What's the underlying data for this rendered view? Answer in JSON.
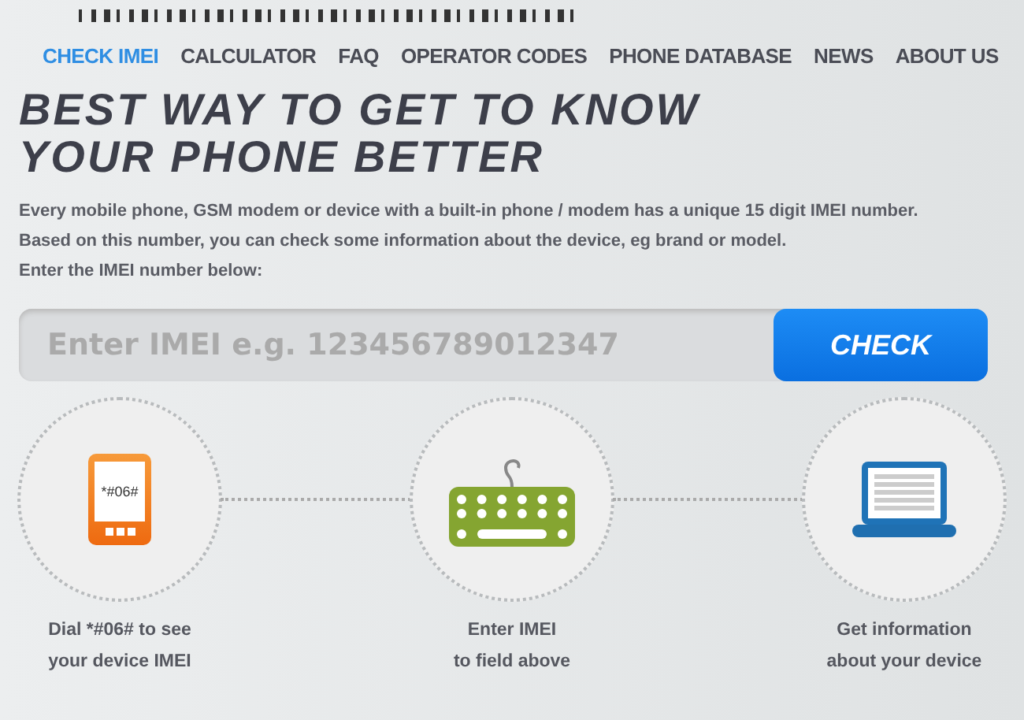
{
  "nav": [
    {
      "label": "CHECK IMEI",
      "selected": true
    },
    {
      "label": "CALCULATOR",
      "selected": false
    },
    {
      "label": "FAQ",
      "selected": false
    },
    {
      "label": "OPERATOR CODES",
      "selected": false
    },
    {
      "label": "PHONE DATABASE",
      "selected": false
    },
    {
      "label": "NEWS",
      "selected": false
    },
    {
      "label": "ABOUT US",
      "selected": false
    }
  ],
  "headline": [
    "BEST WAY TO GET TO KNOW",
    "YOUR PHONE BETTER"
  ],
  "intro": [
    "Every mobile phone, GSM modem or device with a built-in phone / modem has a unique 15 digit IMEI number.",
    "Based on this number, you can check some information about the device, eg brand or model.",
    "Enter the IMEI number below:"
  ],
  "search": {
    "placeholder": "Enter IMEI e.g. 123456789012347",
    "button": "CHECK"
  },
  "steps": [
    {
      "kind": "phone",
      "icon_text": "*#06#",
      "caption": [
        "Dial *#06# to see",
        "your device IMEI"
      ]
    },
    {
      "kind": "keyboard",
      "caption": [
        "Enter IMEI",
        "to field above"
      ]
    },
    {
      "kind": "laptop",
      "caption": [
        "Get information",
        "about your device"
      ]
    }
  ]
}
